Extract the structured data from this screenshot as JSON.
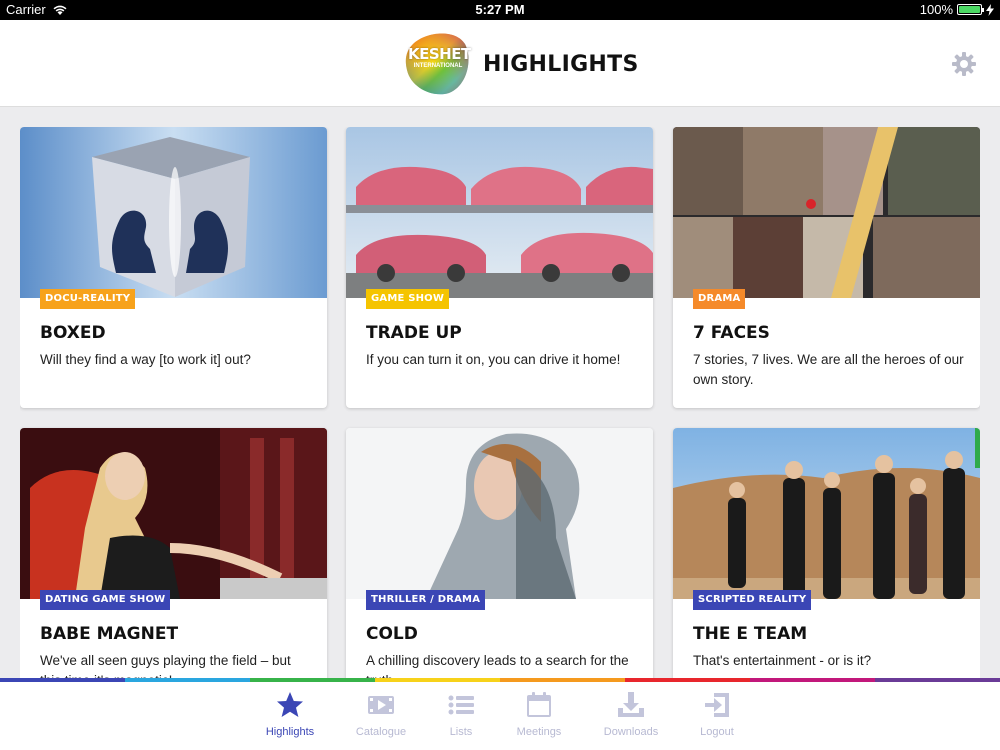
{
  "status_bar": {
    "carrier": "Carrier",
    "time": "5:27 PM",
    "battery": "100%",
    "battery_level": 1.0
  },
  "header": {
    "title": "HIGHLIGHTS",
    "logo_text": "KESHET",
    "logo_subtext": "INTERNATIONAL",
    "settings_icon": "gear-icon"
  },
  "cards": [
    {
      "badge": "DOCU-REALITY",
      "badge_color": "#f7a21b",
      "title": "BOXED",
      "description": "Will they find a way [to work it] out?"
    },
    {
      "badge": "GAME SHOW",
      "badge_color": "#f5c400",
      "title": "TRADE UP",
      "description": "If you can turn it on, you can drive it home!"
    },
    {
      "badge": "DRAMA",
      "badge_color": "#f58a2a",
      "title": "7 FACES",
      "description": "7 stories, 7 lives. We are all the heroes of our own story."
    },
    {
      "badge": "DATING GAME SHOW",
      "badge_color": "#3b46b5",
      "title": "BABE MAGNET",
      "description": "We've all seen guys playing the field – but this time it's magnetic!"
    },
    {
      "badge": "THRILLER / DRAMA",
      "badge_color": "#3b46b5",
      "title": "COLD",
      "description": "A chilling discovery leads to a search for the truth"
    },
    {
      "badge": "SCRIPTED REALITY",
      "badge_color": "#3b46b5",
      "title": "THE E TEAM",
      "description": "That's entertainment - or is it?"
    }
  ],
  "tabs": [
    {
      "label": "Highlights",
      "icon": "star-icon",
      "active": true
    },
    {
      "label": "Catalogue",
      "icon": "film-icon",
      "active": false
    },
    {
      "label": "Lists",
      "icon": "list-icon",
      "active": false
    },
    {
      "label": "Meetings",
      "icon": "calendar-icon",
      "active": false
    },
    {
      "label": "Downloads",
      "icon": "download-icon",
      "active": false
    },
    {
      "label": "Logout",
      "icon": "logout-icon",
      "active": false
    }
  ],
  "colors": {
    "accent": "#3b46b5",
    "inactive_tab": "#b7b9d2"
  }
}
